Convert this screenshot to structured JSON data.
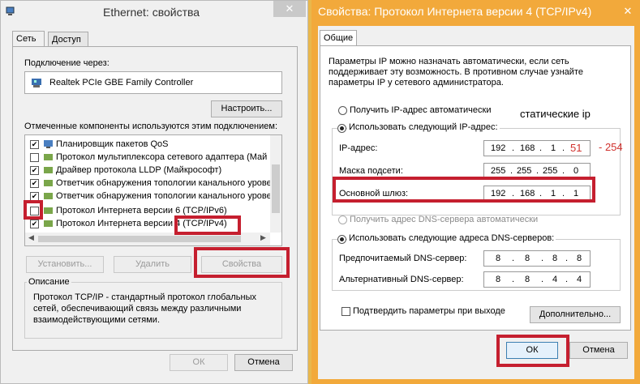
{
  "left_window": {
    "title": "Ethernet: свойства",
    "tabs": [
      {
        "label": "Сеть"
      },
      {
        "label": "Доступ"
      }
    ],
    "connect_via_label": "Подключение через:",
    "adapter_name": "Realtek PCIe GBE Family Controller",
    "configure_button": "Настроить...",
    "components_label": "Отмеченные компоненты используются этим подключением:",
    "components": [
      {
        "label": "Планировщик пакетов QoS",
        "checked": true
      },
      {
        "label": "Протокол мультиплексора сетевого адаптера (Май",
        "checked": false
      },
      {
        "label": "Драйвер протокола LLDP (Майкрософт)",
        "checked": true
      },
      {
        "label": "Ответчик обнаружения топологии канального урове",
        "checked": true
      },
      {
        "label": "Ответчик обнаружения топологии канального урове",
        "checked": true
      },
      {
        "label": "Протокол Интернета версии 6 (TCP/IPv6)",
        "checked": false
      },
      {
        "label": "Протокол Интернета версии 4 (TCP/IPv4)",
        "checked": true
      }
    ],
    "install_button": "Установить...",
    "remove_button": "Удалить",
    "properties_button": "Свойства",
    "description_title": "Описание",
    "description_text": [
      "Протокол TCP/IP - стандартный протокол глобальных",
      "сетей, обеспечивающий связь между различными",
      "взаимодействующими сетями."
    ],
    "ok_button": "ОК",
    "cancel_button": "Отмена"
  },
  "right_window": {
    "title": "Свойства: Протокол Интернета версии 4 (TCP/IPv4)",
    "tab": "Общие",
    "intro_text": [
      "Параметры IP можно назначать автоматически, если сеть",
      "поддерживает эту возможность. В противном случае узнайте",
      "параметры IP у сетевого администратора."
    ],
    "auto_ip_label": "Получить IP-адрес автоматически",
    "static_note": "статические ip",
    "use_ip_label": "Использовать следующий IP-адрес:",
    "ip_label": "IP-адрес:",
    "ip_octets": [
      "192",
      "168",
      "1",
      "51"
    ],
    "range_note": "- 254",
    "mask_label": "Маска подсети:",
    "mask_octets": [
      "255",
      "255",
      "255",
      "0"
    ],
    "gateway_label": "Основной шлюз:",
    "gateway_octets": [
      "192",
      "168",
      "1",
      "1"
    ],
    "auto_dns_label": "Получить адрес DNS-сервера автоматически",
    "use_dns_label": "Использовать следующие адреса DNS-серверов:",
    "preferred_dns_label": "Предпочитаемый DNS-сервер:",
    "preferred_dns_octets": [
      "8",
      "8",
      "8",
      "8"
    ],
    "alternate_dns_label": "Альтернативный DNS-сервер:",
    "alternate_dns_octets": [
      "8",
      "8",
      "4",
      "4"
    ],
    "validate_label": "Подтвердить параметры при выходе",
    "advanced_button": "Дополнительно...",
    "ok_button": "ОК",
    "cancel_button": "Отмена"
  },
  "colors": {
    "highlight_red": "#c51f2f",
    "title_orange": "#f2a93b",
    "annotation_red": "#d0312d"
  }
}
